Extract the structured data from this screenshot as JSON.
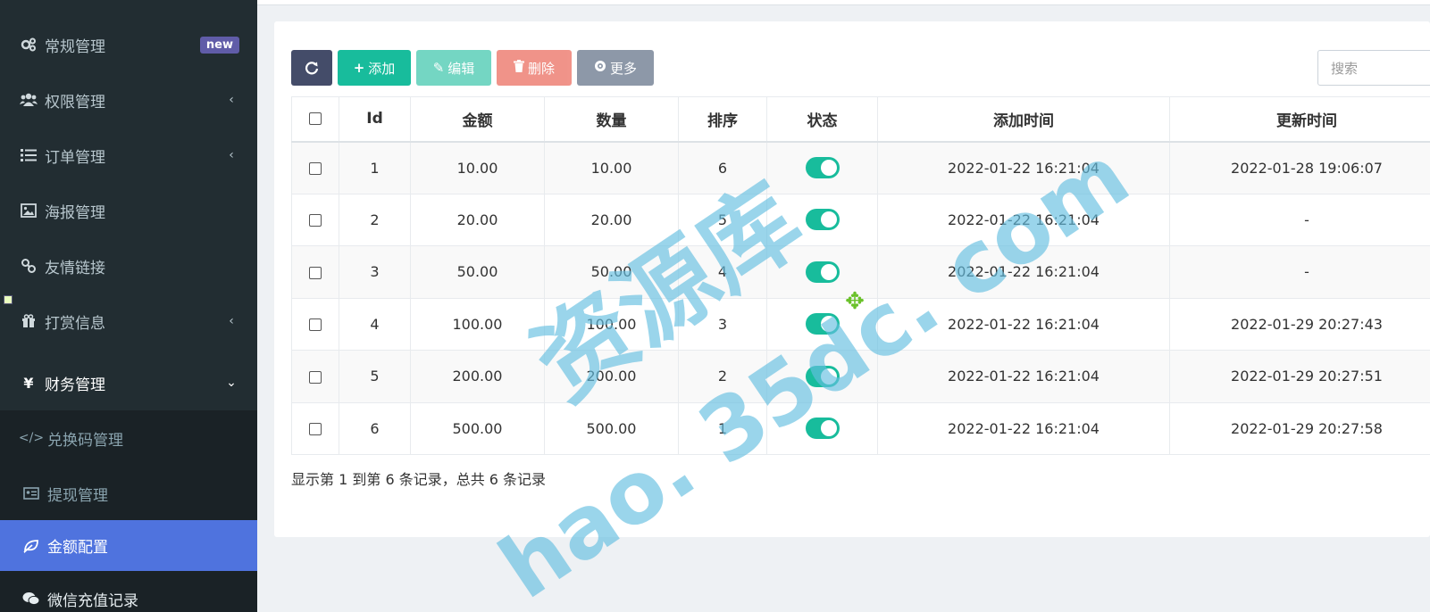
{
  "sidebar": {
    "items": [
      {
        "label": "常规管理",
        "icon": "cogs-icon",
        "badge": "new",
        "chevron": ""
      },
      {
        "label": "权限管理",
        "icon": "group-icon",
        "badge": "",
        "chevron": "‹"
      },
      {
        "label": "订单管理",
        "icon": "list-icon",
        "badge": "",
        "chevron": "‹"
      },
      {
        "label": "海报管理",
        "icon": "image-icon",
        "badge": "",
        "chevron": ""
      },
      {
        "label": "友情链接",
        "icon": "link-icon",
        "badge": "",
        "chevron": ""
      },
      {
        "label": "打赏信息",
        "icon": "gift-icon",
        "badge": "",
        "chevron": "‹"
      },
      {
        "label": "财务管理",
        "icon": "yen-icon",
        "badge": "",
        "chevron": "⌄"
      }
    ],
    "yen_symbol": "¥",
    "sub_items": [
      {
        "label": "兑换码管理",
        "icon": "code-icon"
      },
      {
        "label": "提现管理",
        "icon": "id-card-icon"
      },
      {
        "label": "金额配置",
        "icon": "leaf-icon"
      },
      {
        "label": "微信充值记录",
        "icon": "wechat-icon"
      }
    ]
  },
  "toolbar": {
    "add_label": "添加",
    "edit_label": "编辑",
    "delete_label": "删除",
    "more_label": "更多",
    "search_placeholder": "搜索"
  },
  "table": {
    "headers": [
      "Id",
      "金额",
      "数量",
      "排序",
      "状态",
      "添加时间",
      "更新时间"
    ],
    "rows": [
      {
        "id": "1",
        "amount": "10.00",
        "quantity": "10.00",
        "sort": "6",
        "added": "2022-01-22 16:21:04",
        "updated": "2022-01-28 19:06:07"
      },
      {
        "id": "2",
        "amount": "20.00",
        "quantity": "20.00",
        "sort": "5",
        "added": "2022-01-22 16:21:04",
        "updated": "-"
      },
      {
        "id": "3",
        "amount": "50.00",
        "quantity": "50.00",
        "sort": "4",
        "added": "2022-01-22 16:21:04",
        "updated": "-"
      },
      {
        "id": "4",
        "amount": "100.00",
        "quantity": "100.00",
        "sort": "3",
        "added": "2022-01-22 16:21:04",
        "updated": "2022-01-29 20:27:43"
      },
      {
        "id": "5",
        "amount": "200.00",
        "quantity": "200.00",
        "sort": "2",
        "added": "2022-01-22 16:21:04",
        "updated": "2022-01-29 20:27:51"
      },
      {
        "id": "6",
        "amount": "500.00",
        "quantity": "500.00",
        "sort": "1",
        "added": "2022-01-22 16:21:04",
        "updated": "2022-01-29 20:27:58"
      }
    ]
  },
  "pagination_info": "显示第 1 到第 6 条记录，总共 6 条记录",
  "watermark": {
    "line1": "资源库",
    "line2": "hao. 35dc. com"
  },
  "colors": {
    "sidebar_bg": "#222d32",
    "active_item": "#4f73de",
    "primary": "#18bc9c",
    "danger": "#e74c3c",
    "badge": "#605ca8"
  }
}
